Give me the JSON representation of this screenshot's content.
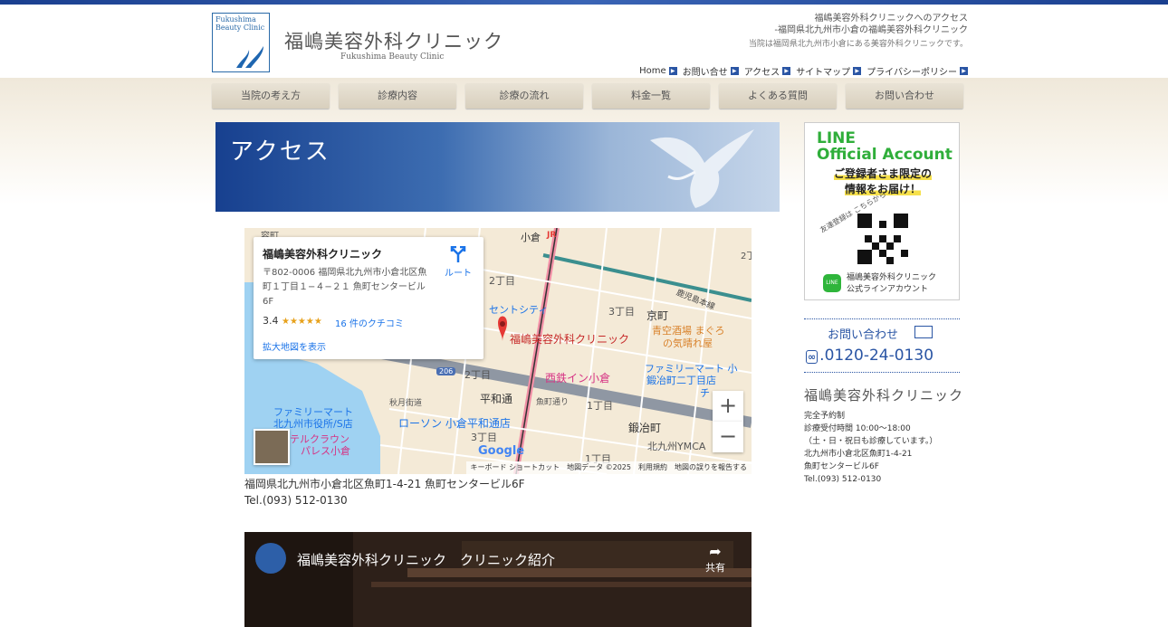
{
  "header": {
    "logo_en_line1": "Fukushima",
    "logo_en_line2": "Beauty Clinic",
    "title": "福嶋美容外科クリニック",
    "subtitle": "Fukushima Beauty Clinic",
    "info_line1": "福嶋美容外科クリニックへのアクセス",
    "info_line2": "-福岡県北九州市小倉の福嶋美容外科クリニック",
    "info_line3": "当院は福岡県北九州市小倉にある美容外科クリニックです。",
    "nav": [
      "Home",
      "お問い合せ",
      "アクセス",
      "サイトマップ",
      "プライバシーポリシー"
    ]
  },
  "global_nav": [
    "当院の考え方",
    "診療内容",
    "診療の流れ",
    "料金一覧",
    "よくある質問",
    "お問い合わせ"
  ],
  "hero": {
    "title": "アクセス"
  },
  "map": {
    "place_name": "福嶋美容外科クリニック",
    "address": "〒802-0006 福岡県北九州市小倉北区魚町１丁目１−４−２１ 魚町センタービル 6F",
    "rating": "3.4",
    "stars": "★★★★★",
    "reviews": "16 件のクチコミ",
    "larger_map": "拡大地図を表示",
    "route": "ルート",
    "zoom_in": "+",
    "zoom_out": "−",
    "footer": "キーボード ショートカット　地図データ ©2025　利用規約　地図の誤りを報告する",
    "google": "Google",
    "labels": {
      "kokura": "小倉",
      "jr": "JR",
      "chome2a": "2丁目",
      "chome3a": "3丁目",
      "kyomachi": "京町",
      "centcity": "セントシティ",
      "marker": "福嶋美容外科クリニック",
      "aozora1": "青空酒場 まぐろ",
      "aozora2": "の気晴れ屋",
      "kagoshima": "鹿児島本線",
      "route206": "206",
      "chome2b": "2丁目",
      "nishitetsu": "西鉄イン小倉",
      "family1a": "ファミリーマート 小",
      "family1b": "鍛冶町二丁目店",
      "heiwadori": "平和通",
      "uomachi": "魚町通り",
      "chome1a": "1丁目",
      "akizuki": "秋月街道",
      "family2a": "ファミリーマート",
      "family2b": "北九州市役所/S店",
      "lawson": "ローソン 小倉平和通店",
      "chome3b": "3丁目",
      "kajimachi": "鍛冶町",
      "telcrown1": "テルクラウン",
      "telcrown2": "パレス小倉",
      "ymca": "北九州YMCA",
      "chome1b": "1丁目",
      "chome2c": "2丁",
      "kaji_cut": "チ",
      "kyomachi_cut": "容町"
    }
  },
  "address_text": "福岡県北九州市小倉北区魚町1-4-21 魚町センタービル6F",
  "tel_text": "Tel.(093) 512-0130",
  "video": {
    "title": "福嶋美容外科クリニック　クリニック紹介",
    "share": "共有"
  },
  "sidebar": {
    "line_title1": "LINE",
    "line_title2": "Official Account",
    "promo1": "ご登録者さま限定の",
    "promo2": "情報をお届け！",
    "friend": "友達登録は こちらから",
    "line_icon": "LINE",
    "account1": "福嶋美容外科クリニック",
    "account2": "公式ラインアカウント",
    "contact_label": "お問い合わせ",
    "freedial": "0120",
    "phone": ".0120-24-0130",
    "clinic_name": "福嶋美容外科クリニック",
    "info": [
      "完全予約制",
      "診療受付時間 10:00～18:00",
      "（土・日・祝日も診療しています。）",
      "北九州市小倉北区魚町1-4-21",
      "魚町センタービル6F",
      "Tel.(093) 512-0130"
    ]
  },
  "colors": {
    "brand_blue": "#2a55a4",
    "line_green": "#2fae3a",
    "map_marker": "#e53935"
  }
}
